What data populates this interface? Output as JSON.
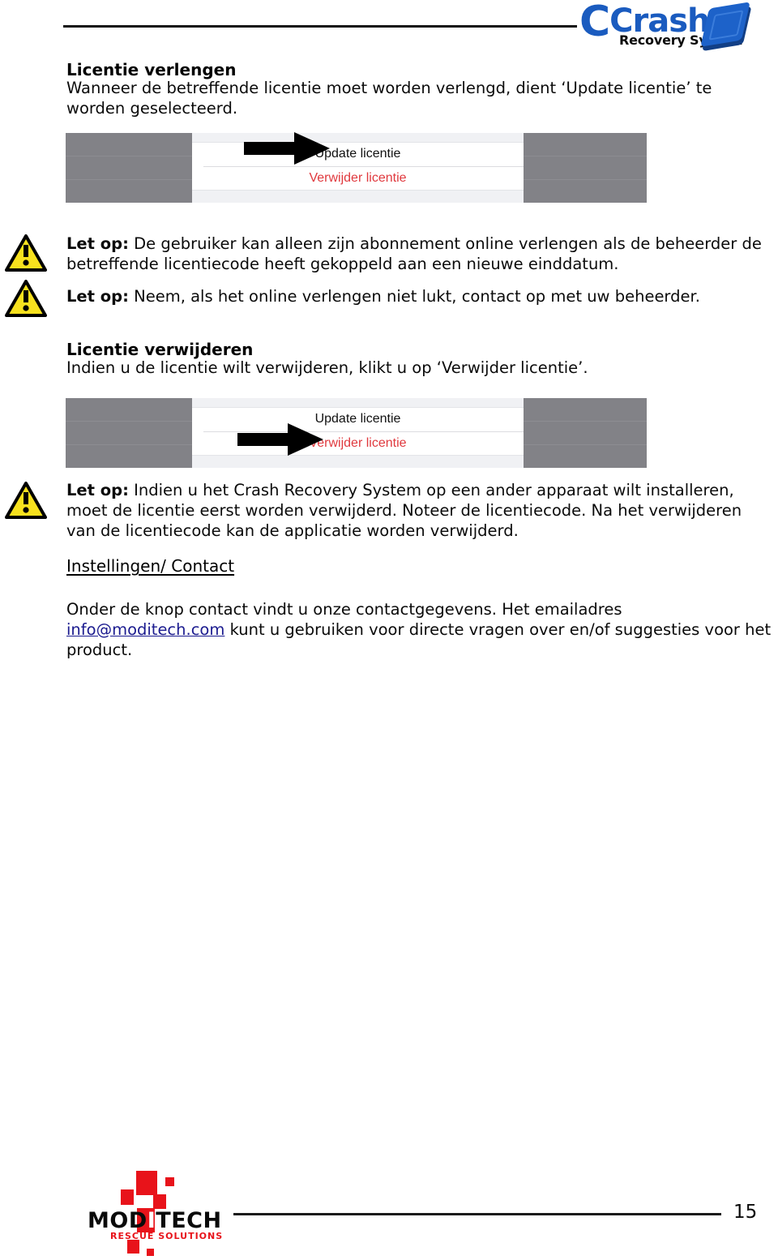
{
  "header": {
    "logo_primary_text": "Crash",
    "logo_sub_text": "Recovery System",
    "logo_color": "#1a5bbf"
  },
  "sections": {
    "license_renew": {
      "heading": "Licentie verlengen",
      "body": "Wanneer de betreffende licentie moet worden verlengd, dient ‘Update licentie’ te worden geselecteerd."
    },
    "license_delete": {
      "heading": "Licentie verwijderen",
      "body": "Indien u de licentie wilt verwijderen, klikt u op ‘Verwijder licentie’."
    },
    "settings_contact": {
      "heading": "Instellingen/ Contact",
      "body_before": "Onder de knop contact vindt u onze contactgegevens. Het emailadres ",
      "email_link": "info@moditech.com",
      "body_after": " kunt u gebruiken voor directe vragen over en/of suggesties voor het product.",
      "link_color": "#1b1b8f"
    }
  },
  "notes": [
    {
      "label": "Let op:",
      "text": " De gebruiker kan alleen zijn abonnement online verlengen als de beheerder de betreffende licentiecode heeft gekoppeld aan een nieuwe einddatum."
    },
    {
      "label": "Let op:",
      "text": " Neem, als het online verlengen niet lukt, contact op met uw beheerder."
    },
    {
      "label": "Let op:",
      "text": " Indien u het Crash Recovery System op een ander apparaat wilt installeren, moet de licentie eerst worden verwijderd. Noteer de licentiecode. Na het verwijderen van de licentiecode kan de applicatie worden verwijderd."
    }
  ],
  "screenshots": [
    {
      "name": "update-licentie-screenshot",
      "row_update": "Update licentie",
      "row_delete": "Verwijder licentie",
      "highlighted_row": "update",
      "update_color": "#111111",
      "delete_color": "#e0393e"
    },
    {
      "name": "verwijder-licentie-screenshot",
      "row_update": "Update licentie",
      "row_delete": "Verwijder licentie",
      "highlighted_row": "delete",
      "update_color": "#111111",
      "delete_color": "#e0393e"
    }
  ],
  "footer": {
    "logo_word": "MODITECH",
    "logo_word_part1": "MOD",
    "logo_word_letter": "I",
    "logo_word_part2": "TECH",
    "logo_tagline": "RESCUE SOLUTIONS",
    "logo_accent_color": "#e8131a",
    "page_number": "15"
  }
}
